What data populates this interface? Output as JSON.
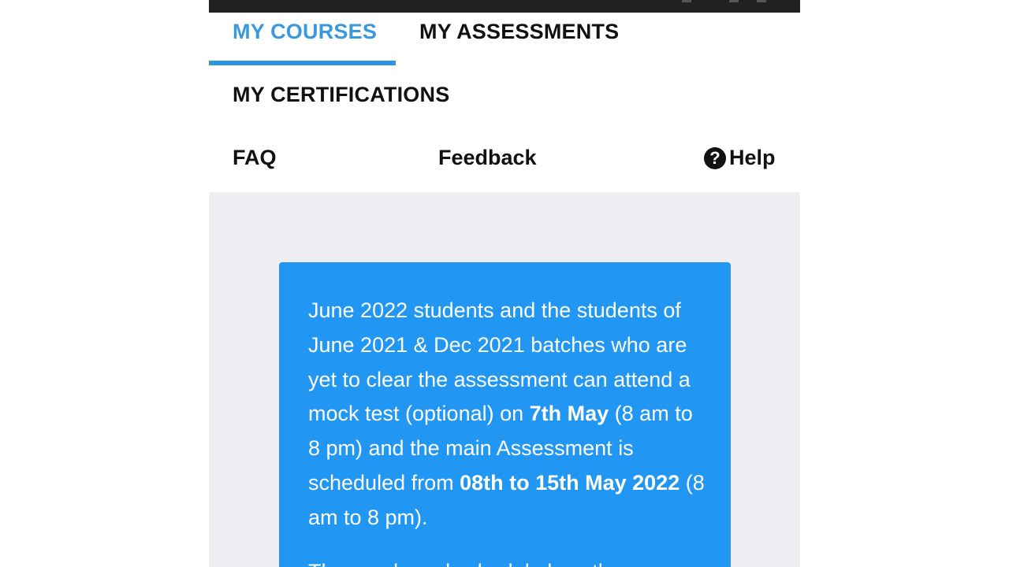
{
  "tabs": [
    {
      "label": "MY COURSES",
      "active": true
    },
    {
      "label": "MY ASSESSMENTS",
      "active": false
    },
    {
      "label": "MY CERTIFICATIONS",
      "active": false
    }
  ],
  "links": {
    "faq": "FAQ",
    "feedback": "Feedback",
    "help": "Help"
  },
  "notice": {
    "part1": "June 2022 students and the students of June 2021 & Dec 2021 batches who are yet to clear the assessment can attend a mock test (optional) on ",
    "mock_date": "7th May",
    "part2": " (8 am to 8 pm) and the main Assessment is scheduled from ",
    "assessment_dates": "08th to 15th May 2022",
    "part3": " (8 am to 8 pm).",
    "next_line": "The needs and schedule how the"
  },
  "colors": {
    "accent": "#3a98dd",
    "card": "#2196f3",
    "background": "#efeff3"
  },
  "icons": {
    "help": "question-circle-icon"
  }
}
